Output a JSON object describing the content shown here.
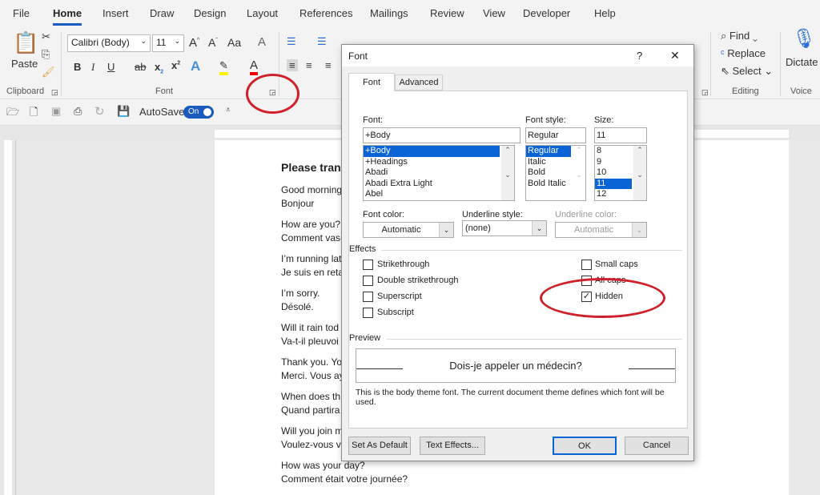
{
  "menu": {
    "tabs": [
      "File",
      "Home",
      "Insert",
      "Draw",
      "Design",
      "Layout",
      "References",
      "Mailings",
      "Review",
      "View",
      "Developer",
      "Help"
    ],
    "active": "Home"
  },
  "ribbon": {
    "clipboard": {
      "paste": "Paste",
      "group": "Clipboard"
    },
    "font": {
      "font_name": "Calibri (Body)",
      "font_size": "11",
      "group": "Font",
      "bold": "B",
      "italic": "I",
      "underline": "U",
      "strike": "ab",
      "change_case": "Aa"
    },
    "editing": {
      "find": "Find",
      "replace": "Replace",
      "select": "Select",
      "group": "Editing"
    },
    "voice": {
      "dictate": "Dictate",
      "group": "Voice"
    }
  },
  "qat": {
    "autosave_label": "AutoSave",
    "autosave_state": "On"
  },
  "document": {
    "title": "Please tran",
    "lines": [
      "Good morning",
      "Bonjour",
      "How are you?",
      "Comment vas-",
      "I’m running lat",
      "Je suis en reta",
      "I’m sorry.",
      "Désolé.",
      "Will it rain tod",
      "Va-t-il pleuvoi",
      "Thank you. Yo",
      "Merci. Vous ay",
      "When does th",
      "Quand partira",
      "Will you join m",
      "Voulez-vous vo",
      "How was your day?",
      "Comment était votre journée?"
    ]
  },
  "dialog": {
    "title": "Font",
    "help": "?",
    "close": "✕",
    "tabs": [
      "Font",
      "Advanced"
    ],
    "font_label": "Font:",
    "font_value": "+Body",
    "font_list": [
      "+Body",
      "+Headings",
      "Abadi",
      "Abadi Extra Light",
      "Abel"
    ],
    "style_label": "Font style:",
    "style_value": "Regular",
    "style_list": [
      "Regular",
      "Italic",
      "Bold",
      "Bold Italic"
    ],
    "size_label": "Size:",
    "size_value": "11",
    "size_list": [
      "8",
      "9",
      "10",
      "11",
      "12"
    ],
    "font_color_label": "Font color:",
    "font_color": "Automatic",
    "underline_style_label": "Underline style:",
    "underline_style": "(none)",
    "underline_color_label": "Underline color:",
    "underline_color": "Automatic",
    "effects_label": "Effects",
    "effects_left": [
      {
        "label": "Strikethrough",
        "checked": false
      },
      {
        "label": "Double strikethrough",
        "checked": false
      },
      {
        "label": "Superscript",
        "checked": false
      },
      {
        "label": "Subscript",
        "checked": false
      }
    ],
    "effects_right": [
      {
        "label": "Small caps",
        "checked": false
      },
      {
        "label": "All caps",
        "checked": false
      },
      {
        "label": "Hidden",
        "checked": true
      }
    ],
    "preview_label": "Preview",
    "preview_text": "Dois-je appeler un médecin?",
    "preview_note": "This is the body theme font. The current document theme defines which font will be used.",
    "buttons": {
      "default": "Set As Default",
      "effects": "Text Effects...",
      "ok": "OK",
      "cancel": "Cancel"
    }
  },
  "colors": {
    "accent": "#185abd",
    "annotation": "#d0202a",
    "selection": "#0a64d6"
  }
}
